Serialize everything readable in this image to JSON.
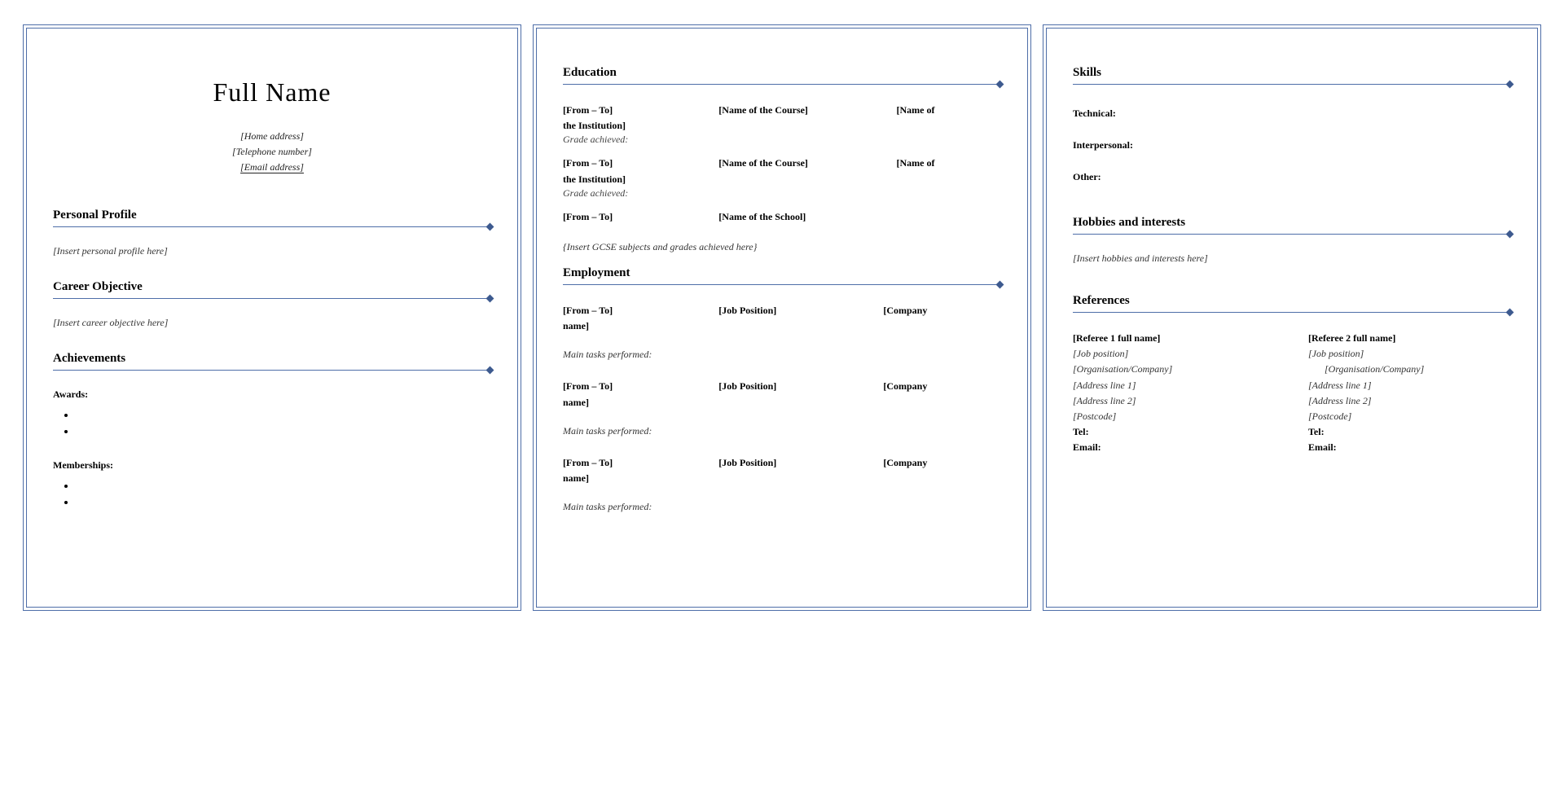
{
  "page1": {
    "name": "Full Name",
    "contact": {
      "address": "[Home address]",
      "telephone": "[Telephone number]",
      "email": "[Email address]"
    },
    "personal_profile_title": "Personal Profile",
    "personal_profile_placeholder": "[Insert personal profile here]",
    "career_objective_title": "Career Objective",
    "career_objective_placeholder": "[Insert career objective here]",
    "achievements_title": "Achievements",
    "awards_label": "Awards:",
    "memberships_label": "Memberships:"
  },
  "page2": {
    "education_title": "Education",
    "edu": [
      {
        "from_to": "[From – To]",
        "course": "[Name of the Course]",
        "inst_prefix": "[Name of",
        "inst_line2": "the Institution]",
        "grade": "Grade achieved:"
      },
      {
        "from_to": "[From – To]",
        "course": "[Name of the Course]",
        "inst_prefix": "[Name of",
        "inst_line2": "the Institution]",
        "grade": "Grade achieved:"
      }
    ],
    "school": {
      "from_to": "[From – To]",
      "school": "[Name of the School]"
    },
    "gcse_placeholder": "{Insert GCSE subjects and grades achieved here}",
    "employment_title": "Employment",
    "jobs": [
      {
        "from_to": "[From – To]",
        "position": "[Job Position]",
        "company_prefix": "[Company",
        "company_line2": "name]",
        "tasks": "Main tasks performed:"
      },
      {
        "from_to": "[From – To]",
        "position": "[Job Position]",
        "company_prefix": "[Company",
        "company_line2": "name]",
        "tasks": "Main tasks performed:"
      },
      {
        "from_to": "[From – To]",
        "position": "[Job Position]",
        "company_prefix": "[Company",
        "company_line2": "name]",
        "tasks": "Main tasks performed:"
      }
    ]
  },
  "page3": {
    "skills_title": "Skills",
    "technical": "Technical:",
    "interpersonal": "Interpersonal:",
    "other": "Other:",
    "hobbies_title": "Hobbies and interests",
    "hobbies_placeholder": "[Insert hobbies and interests here]",
    "references_title": "References",
    "ref1": {
      "name": "[Referee 1 full name]",
      "position": "[Job position]",
      "org": "[Organisation/Company]",
      "addr1": "[Address line 1]",
      "addr2": "[Address line 2]",
      "postcode": "[Postcode]",
      "tel": "Tel:",
      "email": "Email:"
    },
    "ref2": {
      "name": "[Referee 2 full name]",
      "position": "[Job position]",
      "org": "[Organisation/Company]",
      "addr1": "[Address line 1]",
      "addr2": "[Address line 2]",
      "postcode": "[Postcode]",
      "tel": "Tel:",
      "email": "Email:"
    }
  }
}
